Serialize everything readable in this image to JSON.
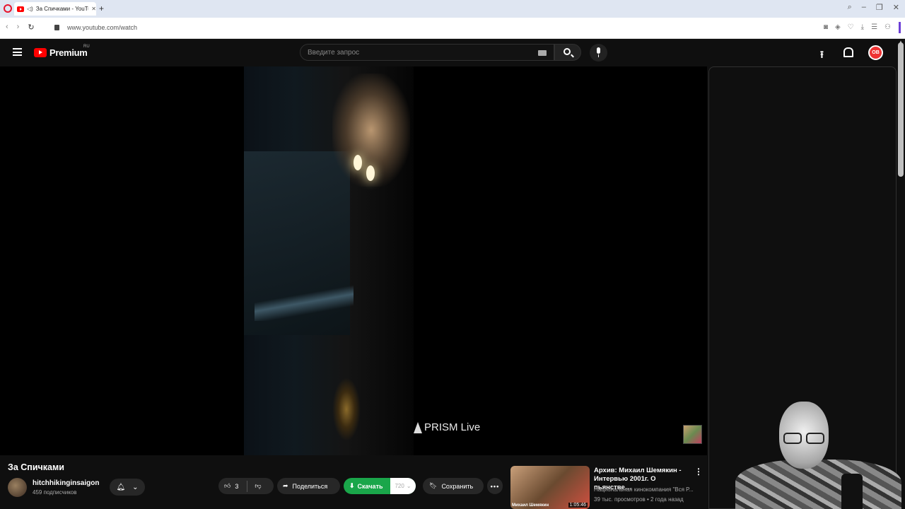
{
  "browser": {
    "tab_title": "За Спичками - YouTube",
    "new_tab": "+",
    "url": "www.youtube.com/watch"
  },
  "header": {
    "logo_text": "Premium",
    "region": "RU",
    "search_placeholder": "Введите запрос",
    "avatar_initials": "OB"
  },
  "player": {
    "watermark": "PRISM Live"
  },
  "video": {
    "title": "За Спичками",
    "channel_name": "hitchhikinginsaigon",
    "subscribers": "459 подписчиков",
    "likes": "3",
    "share_label": "Поделиться",
    "download_label": "Скачать",
    "quality": "720",
    "save_label": "Сохранить",
    "more_label": "•••"
  },
  "recommendation": {
    "title": "Архив: Михаил Шемякин - Интервью 2001г. О пьянстве…",
    "channel": "Национальная кинокомпания \"Вся Р...",
    "meta": "39 тыс. просмотров • 2 года назад",
    "duration": "1:05:46",
    "thumb_caption": "Михаил Шемякин"
  },
  "colors": {
    "accent": "#ff0000",
    "download": "#1aa64a",
    "background": "#0f0f0f"
  }
}
